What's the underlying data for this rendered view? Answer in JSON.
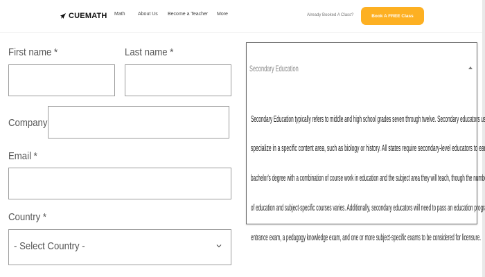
{
  "header": {
    "logo_text": "CUEMATH",
    "nav": [
      "Math",
      "About Us",
      "Become a Teacher",
      "More"
    ],
    "already_booked": "Already Booked A Class?",
    "cta_label": "Book A FREE Class"
  },
  "form": {
    "first_name_label": "First name *",
    "last_name_label": "Last name *",
    "company_label": "Company *",
    "email_label": "Email *",
    "country_label": "Country *",
    "country_selected": "- Select Country -",
    "first_name_value": "",
    "last_name_value": "",
    "company_value": "",
    "email_value": ""
  },
  "accordion": {
    "title": "Secondary Education",
    "expanded": true,
    "body_lines": [
      "Secondary Education typically refers to middle and high school grades seven through twelve. Secondary educators usually",
      "specialize in a specific content area, such as biology or history. All states require secondary-level educators to earn a",
      "bachelor's degree with a combination of course work in education and the subject area they will teach, though the number",
      "of education and subject-specific courses varies. Additionally, secondary educators will need to pass an education program",
      "entrance exam, a pedagogy knowledge exam, and one or more subject-specific exams to be considered for licensure."
    ]
  },
  "colors": {
    "cta": "#fdb022",
    "border": "#9a9a9a"
  },
  "icons": {
    "logo": "rocket-icon",
    "country_dropdown": "chevron-down-icon",
    "accordion_toggle": "chevron-up-icon"
  }
}
